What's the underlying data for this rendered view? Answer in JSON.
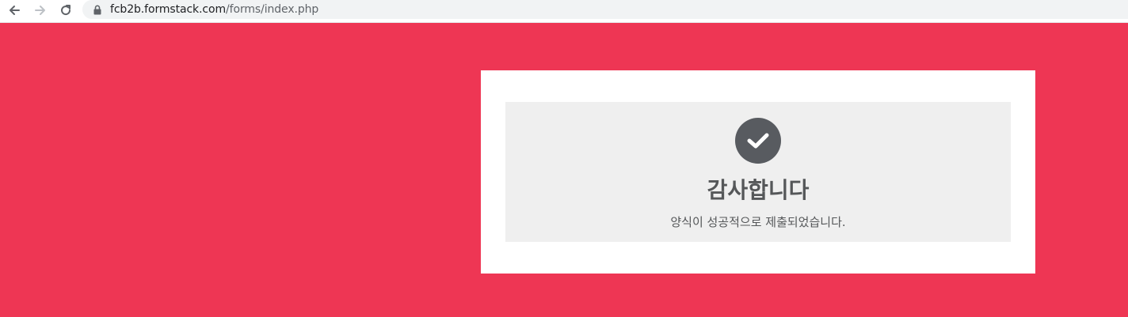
{
  "browser": {
    "url_domain": "fcb2b.formstack.com",
    "url_path": "/forms/index.php",
    "icons": [
      "back-arrow-icon",
      "forward-arrow-icon",
      "reload-icon",
      "lock-icon"
    ]
  },
  "page": {
    "background_color": "#ee3654"
  },
  "confirmation": {
    "icon": "checkmark-icon",
    "title": "감사합니다",
    "message": "양식이 성공적으로 제출되었습니다."
  }
}
